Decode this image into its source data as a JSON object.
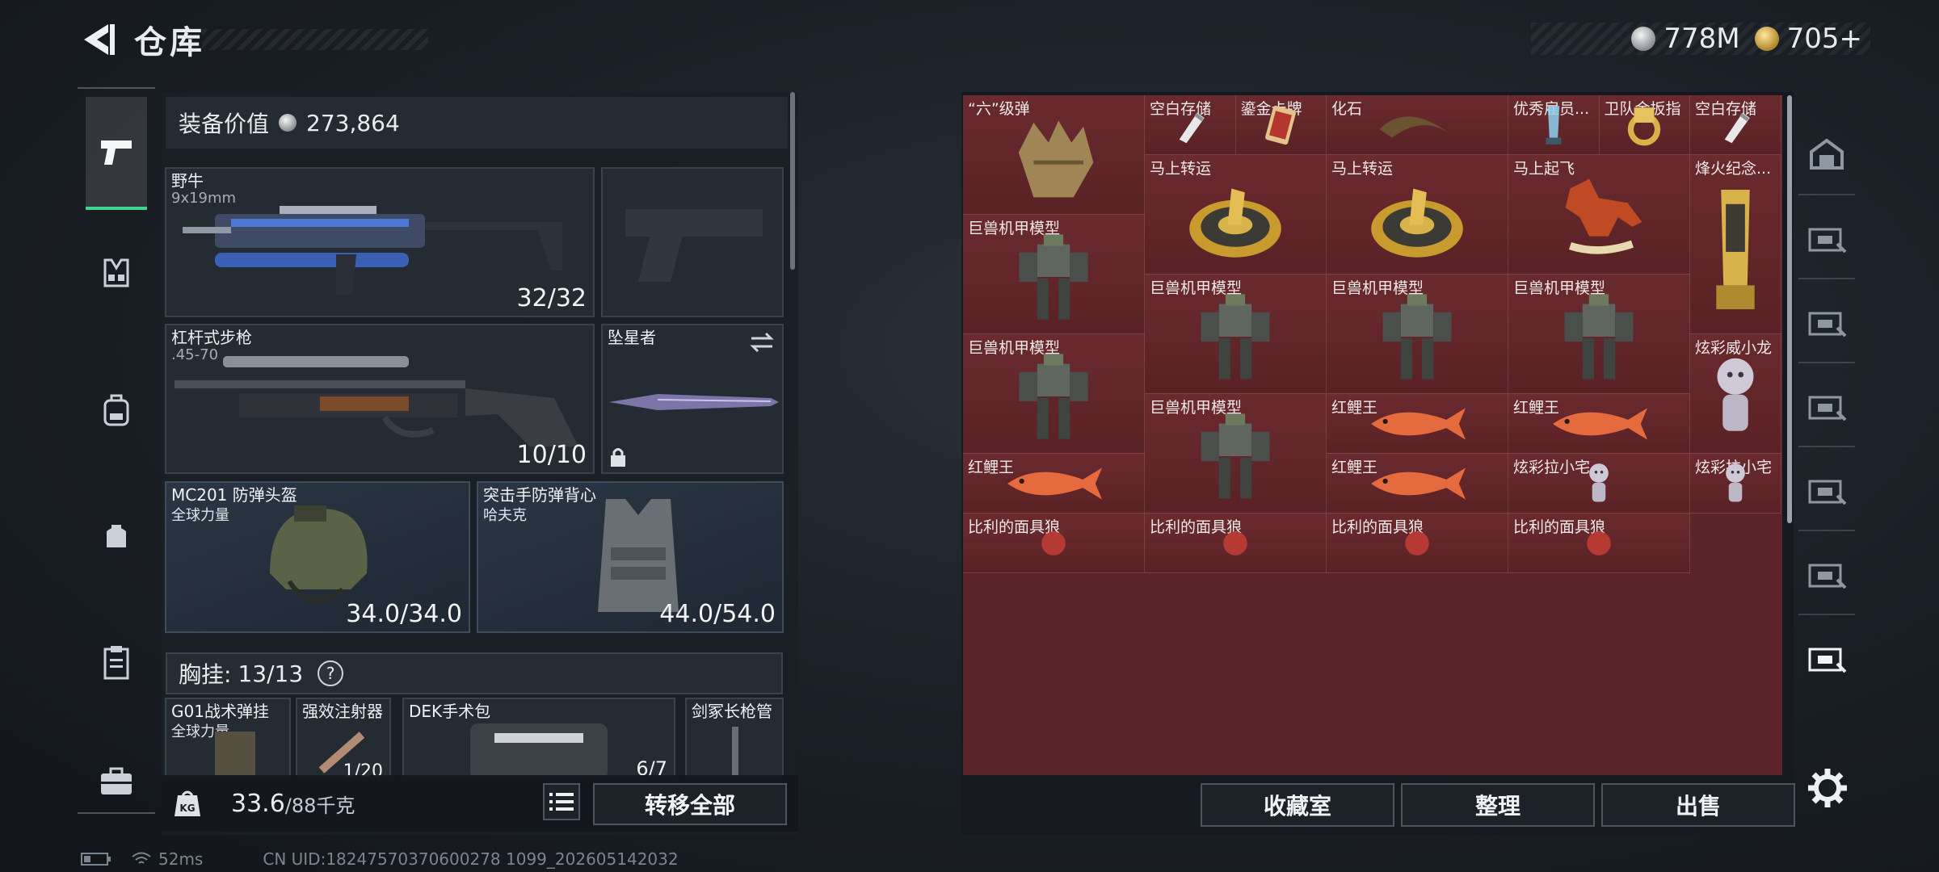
{
  "header": {
    "title": "仓库",
    "currencies": [
      {
        "icon": "silver-coin-icon",
        "value": "778M"
      },
      {
        "icon": "gold-coin-icon",
        "value": "705+"
      }
    ]
  },
  "left_nav": [
    {
      "name": "weapons",
      "icon": "pistol-icon",
      "active": true
    },
    {
      "name": "chest-rig",
      "icon": "vest-icon",
      "active": false
    },
    {
      "name": "backpack",
      "icon": "backpack-icon",
      "active": false
    },
    {
      "name": "pouch",
      "icon": "pouch-icon",
      "active": false
    },
    {
      "name": "medical",
      "icon": "clipboard-icon",
      "active": false
    },
    {
      "name": "case",
      "icon": "briefcase-icon",
      "active": false
    }
  ],
  "loadout": {
    "equip_value_label": "装备价值",
    "equip_value": "273,864",
    "primary_weapon": {
      "name": "野牛",
      "caliber": "9x19mm",
      "ammo": "32/32"
    },
    "secondary_weapon": {
      "name": "杠杆式步枪",
      "caliber": ".45-70",
      "ammo": "10/10"
    },
    "melee": {
      "name": "坠星者"
    },
    "helmet": {
      "name": "MC201 防弹头盔",
      "brand": "全球力量",
      "durability": "34.0/34.0"
    },
    "armor": {
      "name": "突击手防弹背心",
      "brand": "哈夫克",
      "durability": "44.0/54.0"
    },
    "chest": {
      "label": "胸挂:",
      "value": "13/13",
      "help": "?"
    },
    "chest_items": [
      {
        "name": "G01战术弹挂",
        "sub": "全球力量"
      },
      {
        "name": "强效注射器",
        "sub": "1/20"
      },
      {
        "name": "DEK手术包",
        "sub": "6/7"
      },
      {
        "name": "剑冢长枪管",
        "sub": ""
      }
    ],
    "weight": "33.6",
    "weight_max": "/88千克",
    "weight_icon_text": "KG",
    "transfer_all": "转移全部"
  },
  "storage": {
    "items": [
      {
        "label": "“六”级弹",
        "art": "fist"
      },
      {
        "label": "空白存储",
        "art": "usb"
      },
      {
        "label": "鎏金卡牌",
        "art": "card"
      },
      {
        "label": "化石",
        "art": "fossil"
      },
      {
        "label": "优秀雇员...",
        "art": "trophy"
      },
      {
        "label": "卫队金扳指",
        "art": "ring"
      },
      {
        "label": "空白存储",
        "art": "usb"
      },
      {
        "label": "马上转运",
        "art": "horse-coin"
      },
      {
        "label": "马上转运",
        "art": "horse-coin"
      },
      {
        "label": "马上起飞",
        "art": "red-horse"
      },
      {
        "label": "烽火纪念...",
        "art": "gold-trophy"
      },
      {
        "label": "巨兽机甲模型",
        "art": "mech"
      },
      {
        "label": "巨兽机甲模型",
        "art": "mech"
      },
      {
        "label": "巨兽机甲模型",
        "art": "mech"
      },
      {
        "label": "巨兽机甲模型",
        "art": "mech"
      },
      {
        "label": "巨兽机甲模型",
        "art": "mech"
      },
      {
        "label": "炫彩威小龙",
        "art": "figure"
      },
      {
        "label": "巨兽机甲模型",
        "art": "mech"
      },
      {
        "label": "红鲤王",
        "art": "fish"
      },
      {
        "label": "红鲤王",
        "art": "fish"
      },
      {
        "label": "红鲤王",
        "art": "fish"
      },
      {
        "label": "红鲤王",
        "art": "fish"
      },
      {
        "label": "炫彩拉小宅",
        "art": "figure"
      },
      {
        "label": "炫彩拉小宅",
        "art": "figure"
      },
      {
        "label": "比利的面具狼",
        "art": "mask"
      },
      {
        "label": "比利的面具狼",
        "art": "mask"
      },
      {
        "label": "比利的面具狼",
        "art": "mask"
      },
      {
        "label": "比利的面具狼",
        "art": "mask"
      }
    ],
    "buttons": {
      "collection": "收藏室",
      "sort": "整理",
      "sell": "出售"
    }
  },
  "right_nav": [
    {
      "icon": "warehouse-icon"
    },
    {
      "icon": "storage-ii-icon"
    },
    {
      "icon": "storage-iii-icon"
    },
    {
      "icon": "storage-iv-icon"
    },
    {
      "icon": "storage-v-icon"
    },
    {
      "icon": "storage-vi-icon"
    },
    {
      "icon": "storage-vii-icon"
    }
  ],
  "status": {
    "ping": "52ms",
    "uid": "CN UID:18247570370600278 1099_202605142032"
  },
  "colors": {
    "accent_green": "#3fd68f",
    "storage_cell": "#6a2a2e",
    "coin_gold": "#d6a83a"
  }
}
